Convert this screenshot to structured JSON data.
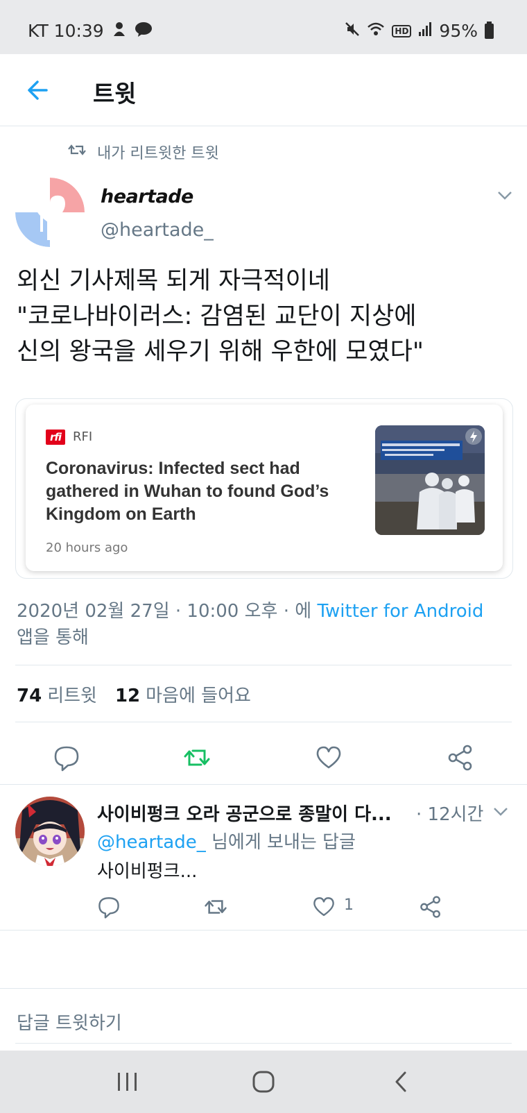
{
  "status_bar": {
    "carrier_time": "KT 10:39",
    "battery": "95%",
    "icons": [
      "person-icon",
      "kakaotalk-icon",
      "mute-icon",
      "wifi-icon",
      "hd-icon",
      "signal-icon",
      "battery-icon"
    ],
    "hd_label": "HD"
  },
  "app_bar": {
    "title": "트윗",
    "back_icon": "arrow-left-icon"
  },
  "tweet": {
    "retweet_label": "내가 리트윗한 트윗",
    "author_name": "heartade",
    "author_handle": "@heartade_",
    "text_lines": [
      "외신 기사제목 되게 자극적이네",
      "\"코로나바이러스: 감염된 교단이 지상에",
      "신의 왕국을 세우기 위해 우한에 모였다\""
    ],
    "card": {
      "source_logo": "rfi",
      "source": "RFI",
      "title": "Coronavirus: Infected sect had gathered in Wuhan to found God’s Kingdom on Earth",
      "time": "20 hours ago"
    },
    "timestamp": "2020년 02월 27일 · 10:00 오후 · 에 ",
    "via": "Twitter for Android",
    "via_suffix": "앱을 통해",
    "retweets": "74",
    "retweets_label": "리트윗",
    "likes": "12",
    "likes_label": "마음에 들어요",
    "accent_color": "#1da1f2",
    "retweet_active_color": "#17bf63"
  },
  "reply": {
    "name": "사이비펑크 오라 공군으로 종말이 다...",
    "time": "· 12시간",
    "reply_to_mention": "@heartade_",
    "reply_to_suffix": " 님에게 보내는 답글",
    "text": "사이비펑크...",
    "like_count": "1"
  },
  "compose": {
    "placeholder": "답글 트윗하기"
  },
  "nav": {
    "recent_icon": "recent-apps-icon",
    "home_icon": "home-icon",
    "back_icon": "back-icon"
  }
}
